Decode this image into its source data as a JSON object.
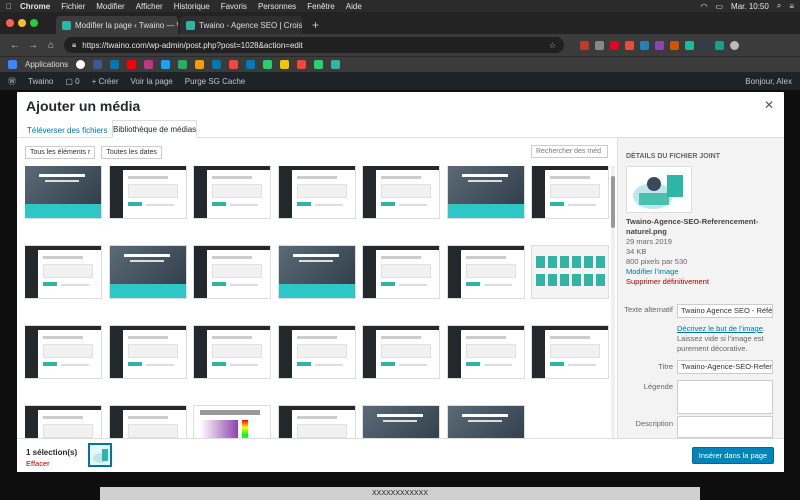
{
  "mac": {
    "app": "Chrome",
    "menus": [
      "Fichier",
      "Modifier",
      "Afficher",
      "Historique",
      "Favoris",
      "Personnes",
      "Fenêtre",
      "Aide"
    ],
    "clock": "Mar. 10:50"
  },
  "browser": {
    "tabs": [
      {
        "title": "Modifier la page ‹ Twaino — W"
      },
      {
        "title": "Twaino - Agence SEO | Croissa"
      }
    ],
    "url": "https://twaino.com/wp-admin/post.php?post=1028&action=edit",
    "bookmarks_label": "Applications"
  },
  "wpadmin": {
    "site": "Twaino",
    "new": "+ Créer",
    "view": "Voir la page",
    "purge": "Purge SG Cache",
    "greeting": "Bonjour, Alex"
  },
  "modal": {
    "title": "Ajouter un média",
    "tabs": [
      "Téléverser des fichiers",
      "Bibliothèque de médias"
    ],
    "filter_type": "Tous les éléments r",
    "filter_date": "Toutes les dates",
    "search_placeholder": "Rechercher des méd",
    "grid_types": [
      "hero",
      "admin",
      "admin",
      "admin",
      "admin",
      "hero",
      "admin",
      "admin",
      "hero",
      "admin",
      "hero",
      "admin",
      "admin",
      "teal",
      "admin",
      "admin",
      "admin",
      "admin",
      "admin",
      "admin",
      "admin",
      "admin",
      "admin",
      "palette",
      "admin",
      "hero",
      "hero"
    ]
  },
  "details": {
    "heading": "Détails du fichier joint",
    "filename": "Twaino-Agence-SEO-Referencement-naturel.png",
    "date": "29 mars 2019",
    "size": "34 KB",
    "dimensions": "800 pixels par 530",
    "edit_link": "Modifier l’image",
    "delete_link": "Supprimer définitivement",
    "alt_label": "Texte alternatif",
    "alt_value": "Twaino Agence SEO - Référ",
    "alt_help_link": "Décrivez le but de l’image",
    "alt_help_text": ". Laissez vide si l’image est purement décorative.",
    "title_label": "Titre",
    "title_value": "Twaino-Agence-SEO-Referen",
    "caption_label": "Légende",
    "description_label": "Description"
  },
  "footer": {
    "selection": "1 sélection(s)",
    "clear": "Effacer",
    "insert": "Insérer dans la page"
  },
  "background": {
    "bottom_text": "XXXXXXXXXXXX"
  }
}
